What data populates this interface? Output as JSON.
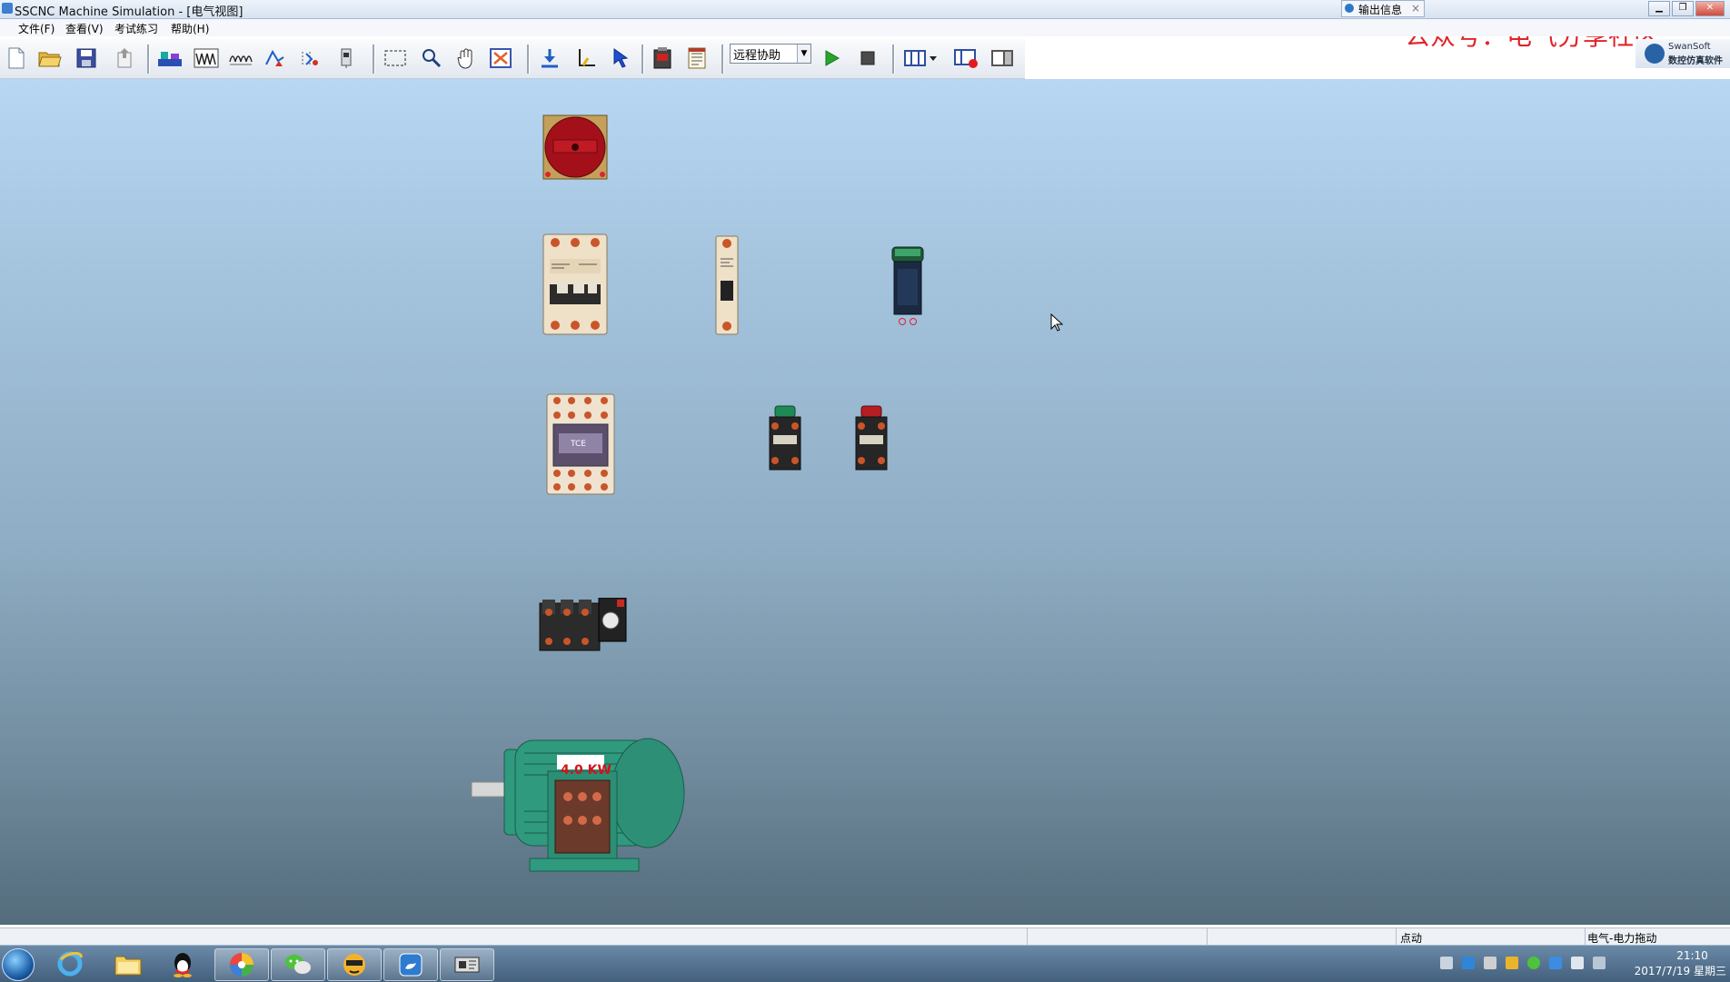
{
  "window": {
    "title": "SSCNC Machine Simulation - [电气视图]",
    "output_tab": "输出信息",
    "output_tab_close": "×",
    "wm_minimize": "▁",
    "wm_restore": "❐",
    "wm_close": "✕"
  },
  "menu": [
    "文件(F)",
    "查看(V)",
    "考试练习",
    "帮助(H)"
  ],
  "toolbar": {
    "mode_select": "远程协助",
    "brand_line1": "SwanSoft",
    "brand_line2": "数控仿真软件"
  },
  "watermark": "公众号：电气分享社区",
  "components": {
    "motor_label": "4.0 KW",
    "contactor_brand": "TCE"
  },
  "statusbar": {
    "mode": "点动",
    "category": "电气-电力拖动"
  },
  "taskbar": {
    "time": "21:10",
    "date": "2017/7/19 星期三"
  },
  "colors": {
    "canvas_top": "#b7d7f3",
    "canvas_bottom": "#546c7c",
    "watermark": "#e0242a",
    "motor_green": "#2f9a7e",
    "switch_red": "#a4101a"
  }
}
